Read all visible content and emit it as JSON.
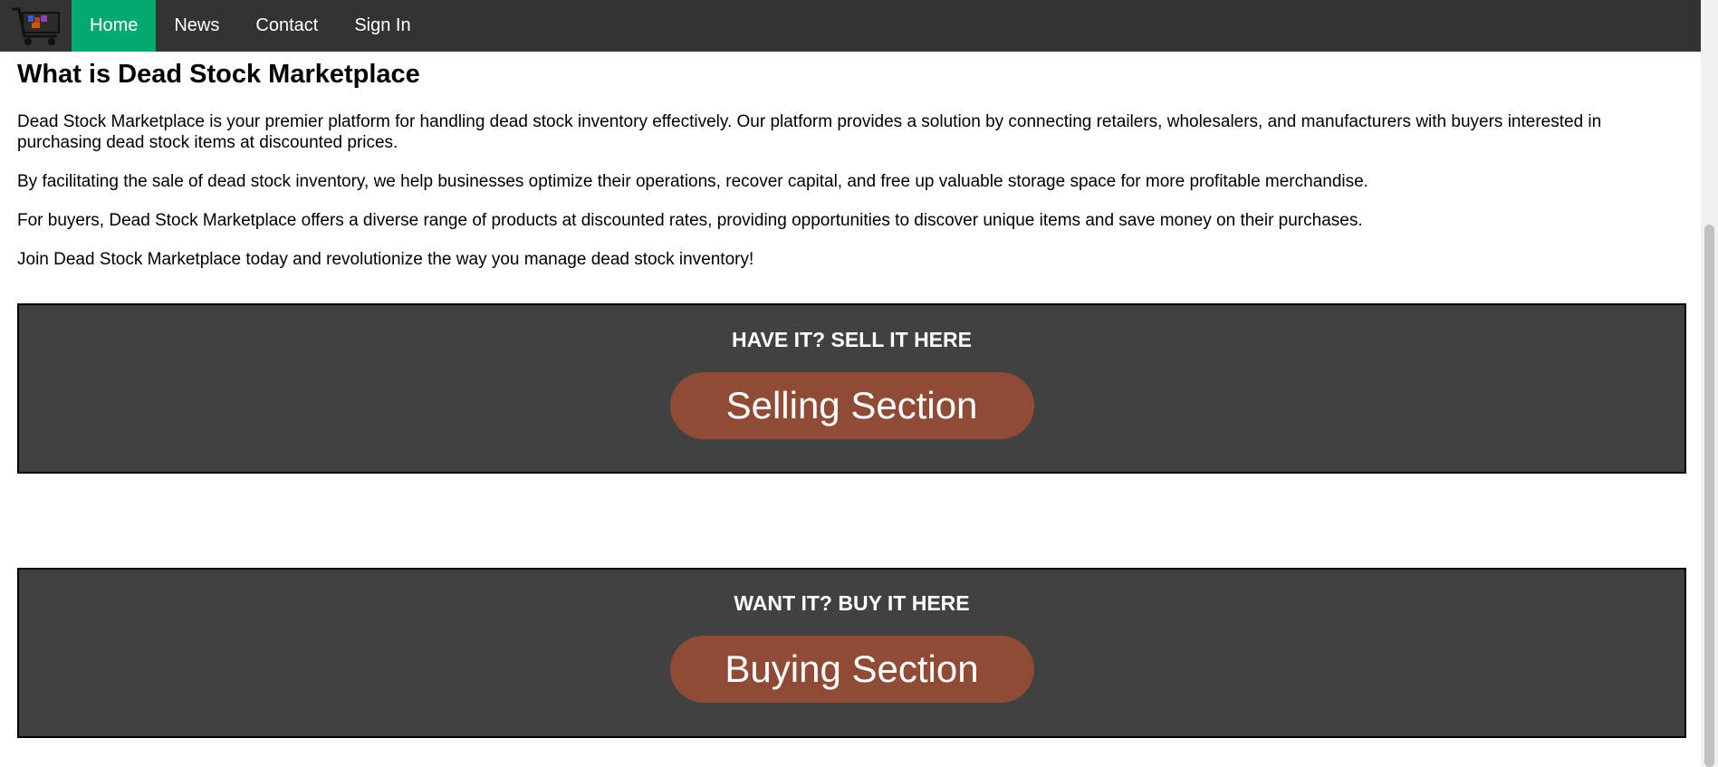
{
  "nav": {
    "logo_icon": "shopping-cart-icon",
    "items": [
      {
        "label": "Home",
        "active": true
      },
      {
        "label": "News",
        "active": false
      },
      {
        "label": "Contact",
        "active": false
      },
      {
        "label": "Sign In",
        "active": false
      }
    ],
    "active_color": "#04AA6D",
    "background": "#333333"
  },
  "content": {
    "heading": "What is Dead Stock Marketplace",
    "paragraphs": [
      "Dead Stock Marketplace is your premier platform for handling dead stock inventory effectively. Our platform provides a solution by connecting retailers, wholesalers, and manufacturers with buyers interested in purchasing dead stock items at discounted prices.",
      "By facilitating the sale of dead stock inventory, we help businesses optimize their operations, recover capital, and free up valuable storage space for more profitable merchandise.",
      "For buyers, Dead Stock Marketplace offers a diverse range of products at discounted rates, providing opportunities to discover unique items and save money on their purchases.",
      "Join Dead Stock Marketplace today and revolutionize the way you manage dead stock inventory!"
    ]
  },
  "sell_panel": {
    "title": "HAVE IT? SELL IT HERE",
    "button_label": "Selling Section"
  },
  "buy_panel": {
    "title": "WANT IT? BUY IT HERE",
    "button_label": "Buying Section"
  },
  "colors": {
    "panel": "#414141",
    "button": "#8f4b35"
  }
}
